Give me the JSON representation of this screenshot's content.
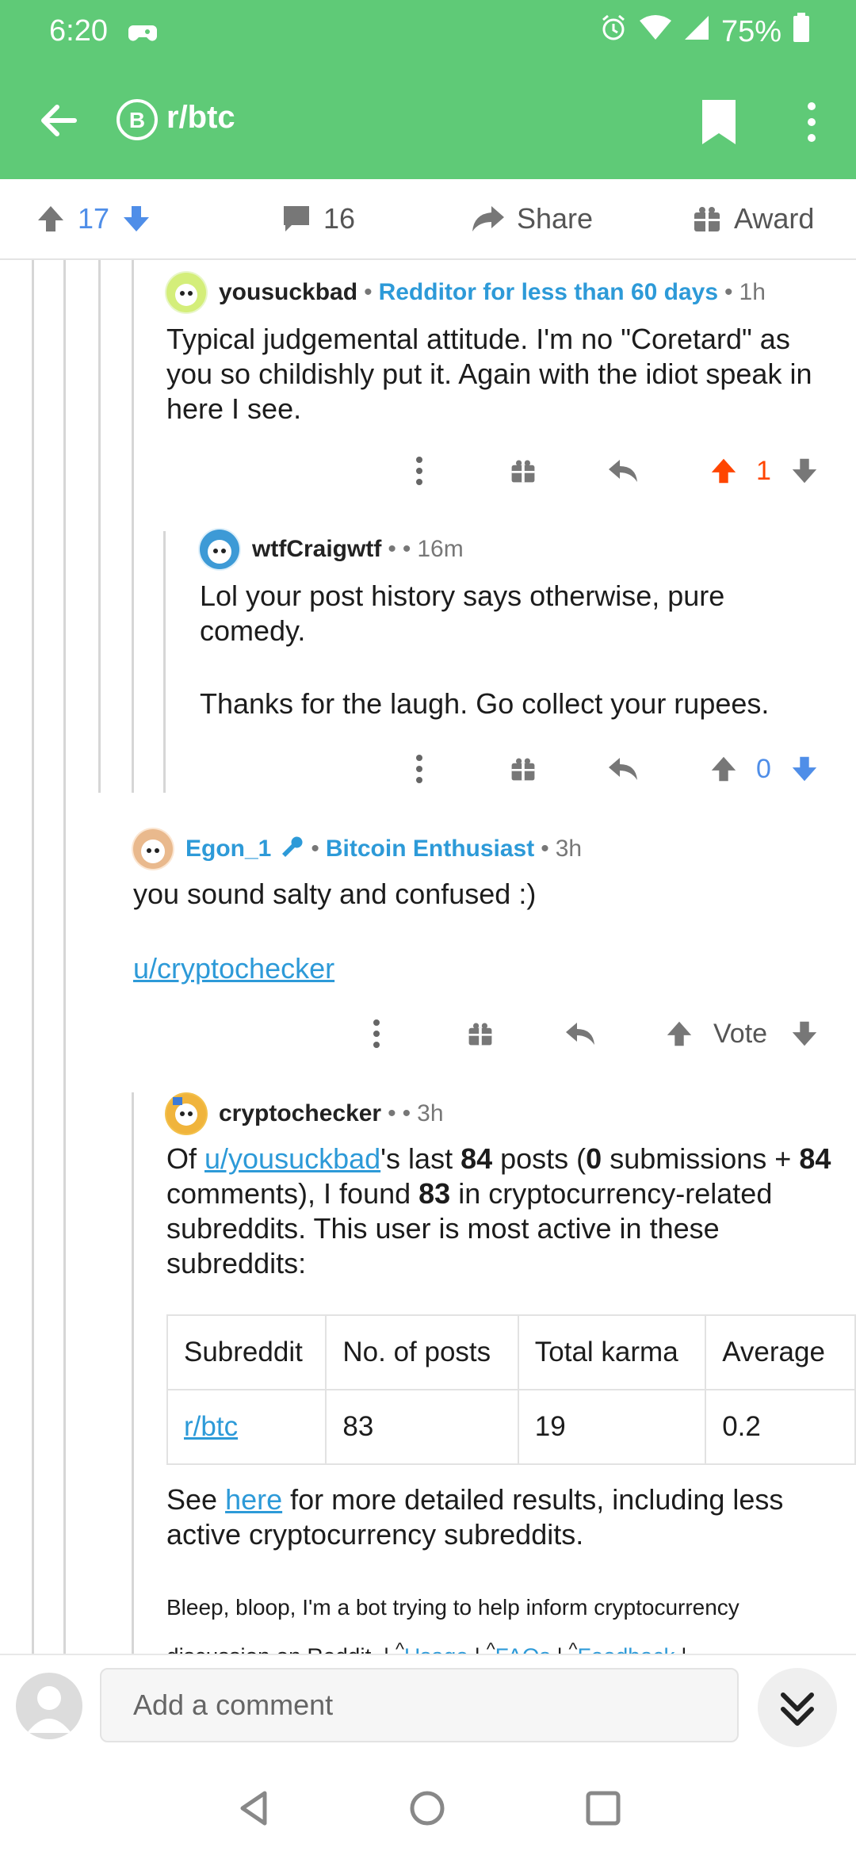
{
  "status_bar": {
    "time": "6:20",
    "battery": "75%"
  },
  "app_bar": {
    "subreddit": "r/btc"
  },
  "post_actions": {
    "upvotes": "17",
    "comments": "16",
    "share": "Share",
    "award": "Award"
  },
  "comments": [
    {
      "author": "yousuckbad",
      "flair": "Redditor for less than 60 days",
      "time": "1h",
      "body": "Typical judgemental attitude. I'm no \"Coretard\" as you so childishly put it. Again with the idiot speak in here I see.",
      "score": "1"
    },
    {
      "author": "wtfCraigwtf",
      "time": "16m",
      "body_p1": "Lol your post history says otherwise, pure comedy.",
      "body_p2": "Thanks for the laugh. Go collect your rupees.",
      "score": "0"
    },
    {
      "author": "Egon_1",
      "flair": "Bitcoin Enthusiast",
      "time": "3h",
      "body_p1": "you sound salty and confused :)",
      "link": "u/cryptochecker",
      "score": "Vote"
    },
    {
      "author": "cryptochecker",
      "time": "3h",
      "intro": {
        "t1": "Of ",
        "user_link": "u/yousuckbad",
        "t2": "'s last ",
        "n1": "84",
        "t3": " posts (",
        "n2": "0",
        "t4": " submissions + ",
        "n3": "84",
        "t5": " comments), I found ",
        "n4": "83",
        "t6": " in cryptocurrency-related subreddits. This user is most active in these subreddits:"
      },
      "table": {
        "headers": [
          "Subreddit",
          "No. of posts",
          "Total karma",
          "Average"
        ],
        "rows": [
          [
            "r/btc",
            "83",
            "19",
            "0.2"
          ]
        ]
      },
      "see": {
        "t1": "See ",
        "link": "here",
        "t2": " for more detailed results, including less active cryptocurrency subreddits."
      },
      "bot_note": "Bleep, bloop, I'm a bot trying to help inform cryptocurrency discussion on Reddit. |",
      "bot_links": [
        "Usage",
        "FAQs",
        "Feedback"
      ]
    }
  ],
  "comment_bar": {
    "placeholder": "Add a comment"
  },
  "colors": {
    "header": "#5fca77",
    "upvote_active": "#ff4500",
    "downvote": "#4f8ee8",
    "link": "#2d9ad8"
  }
}
